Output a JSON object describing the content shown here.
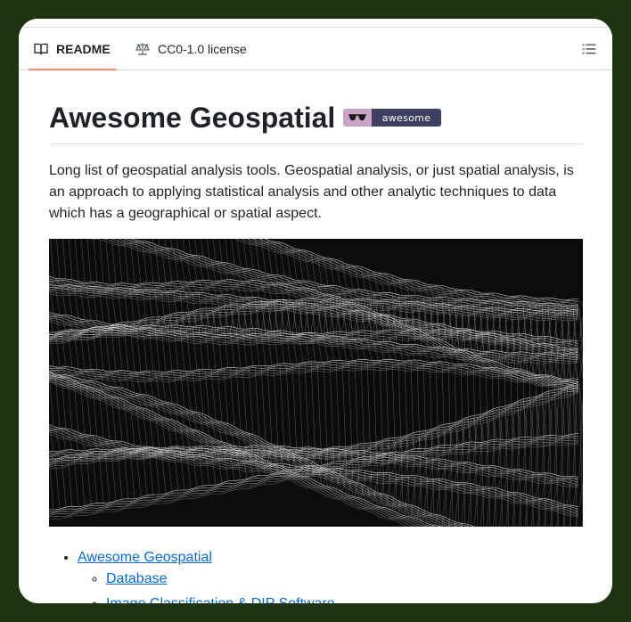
{
  "tabs": {
    "readme_label": "README",
    "license_label": "CC0-1.0 license"
  },
  "icons": {
    "readme": "book-icon",
    "license": "scale-icon",
    "outline": "list-unordered-icon"
  },
  "readme": {
    "title": "Awesome Geospatial",
    "badge_text": "awesome",
    "description": "Long list of geospatial analysis tools. Geospatial analysis, or just spatial analysis, is an approach to applying statistical analysis and other analytic techniques to data which has a geographical or spatial aspect.",
    "toc": {
      "top_item": "Awesome Geospatial",
      "sub_items": [
        "Database",
        "Image Classification & DIP Software"
      ]
    }
  },
  "colors": {
    "background": "#1e3410",
    "tab_underline": "#fd8c73",
    "link": "#0969da",
    "badge_left": "#c8a5c8",
    "badge_right": "#3f3f5f"
  }
}
